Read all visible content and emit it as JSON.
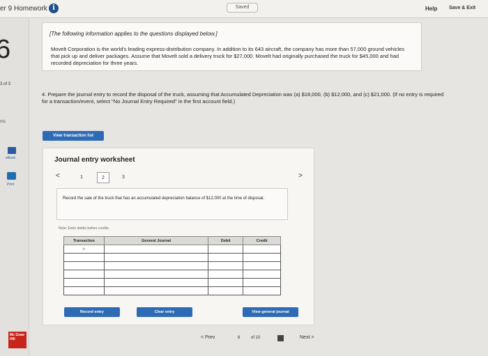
{
  "topbar": {
    "title": "er 9 Homework",
    "info_icon": "info-icon",
    "saved": "Saved",
    "help": "Help",
    "save_exit": "Save & Exit"
  },
  "left_rail": {
    "question_number": "6",
    "progress": "3 of 3",
    "points": "nts",
    "ebook": "eBook",
    "print": "Print",
    "logo": "Mc Graw Hill"
  },
  "info_box": {
    "lead": "[The following information applies to the questions displayed below.]",
    "body": "Movelt Corporation is the world's leading express-distribution company. In addition to its 643 aircraft, the company has more than 57,000 ground vehicles that pick up and deliver packages. Assume that Movelt sold a delivery truck for $27,000. Movelt had originally purchased the truck for $45,000 and had recorded depreciation for three years."
  },
  "question": {
    "text": "4. Prepare the journal entry to record the disposal of the truck, assuming that Accumulated Depreciation was (a) $18,000, (b) $12,000, and (c) $21,000. (If no entry is required for a transaction/event, select \"No Journal Entry Required\" in the first account field.)"
  },
  "buttons": {
    "view_transaction_list": "View transaction list"
  },
  "worksheet": {
    "title": "Journal entry worksheet",
    "prev": "<",
    "next": ">",
    "tabs": [
      "1",
      "2",
      "3"
    ],
    "instruction": "Record the sale of the truck that has an accumulated depreciation balance of $12,000 at the time of disposal.",
    "note": "Note: Enter debits before credits.",
    "columns": [
      "Transaction",
      "General Journal",
      "Debit",
      "Credit"
    ],
    "transaction_value": "b",
    "record_entry": "Record entry",
    "clear_entry": "Clear entry",
    "view_general_journal": "View general journal"
  },
  "pager": {
    "prev": "< Prev",
    "current": "6",
    "of": "of 10",
    "next": "Next >"
  }
}
